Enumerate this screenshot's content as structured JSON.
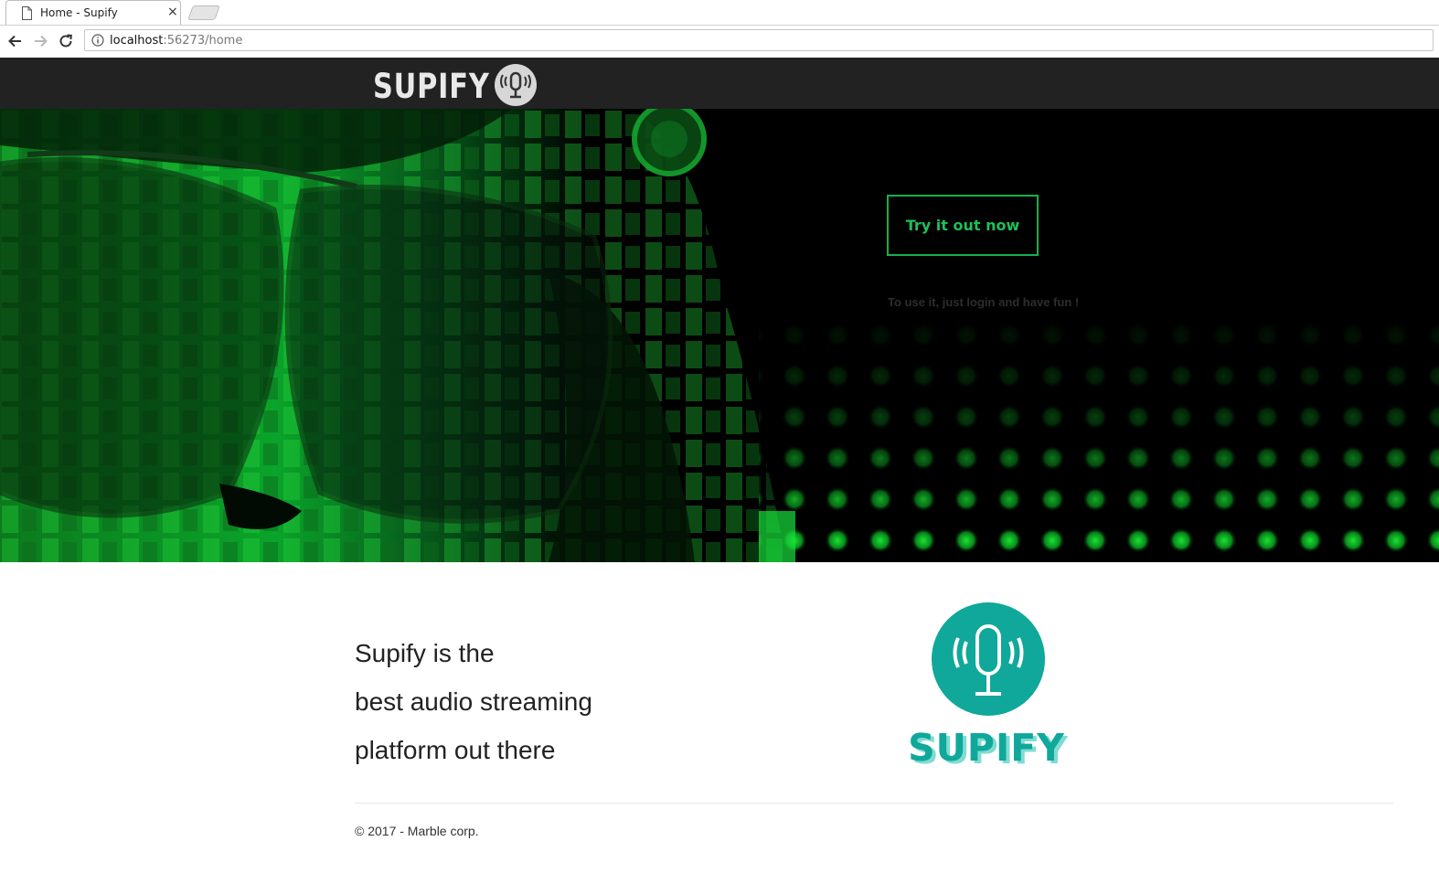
{
  "browser": {
    "tab_title": "Home - Supify",
    "tab_close": "×",
    "url_host": "localhost",
    "url_rest": ":56273/home",
    "icons": [
      "document-icon",
      "close-icon",
      "back-arrow-icon",
      "forward-arrow-icon",
      "reload-icon",
      "info-icon"
    ]
  },
  "nav": {
    "brand": "SUPIFY",
    "logo_icon": "microphone-icon"
  },
  "hero": {
    "cta_label": "Try it out now",
    "subtitle": "To use it, just login and have fun !",
    "accent_color": "#16b04e"
  },
  "main": {
    "tagline_lines": [
      "Supify is the",
      "best audio streaming",
      "platform out there"
    ],
    "logo_text": "SUPIFY",
    "logo_color": "#0fa89a"
  },
  "footer": {
    "copyright": "© 2017 - Marble corp."
  }
}
